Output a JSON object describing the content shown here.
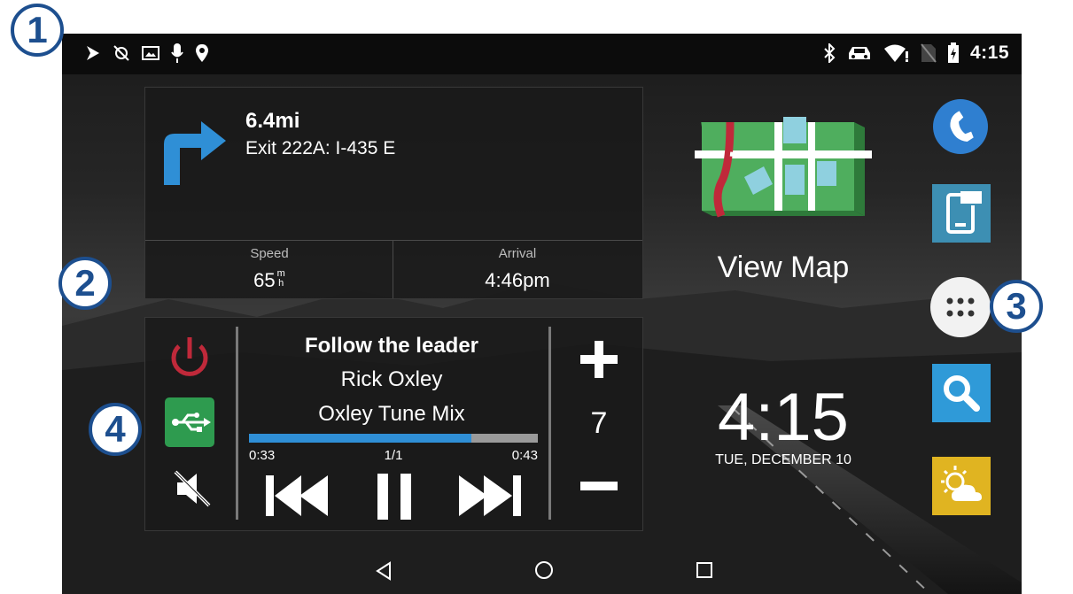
{
  "status_bar": {
    "left_icons": [
      "navigation-icon",
      "no-gps-icon",
      "image-icon",
      "microphone-icon",
      "location-pin-icon"
    ],
    "right_icons": [
      "bluetooth-icon",
      "car-icon",
      "wifi-alert-icon",
      "no-sim-icon",
      "battery-charging-icon"
    ],
    "time": "4:15"
  },
  "navigation": {
    "distance": "6.4mi",
    "instruction": "Exit 222A: I-435 E",
    "speed_label": "Speed",
    "speed_value": "65",
    "speed_unit_top": "m",
    "speed_unit_bottom": "h",
    "arrival_label": "Arrival",
    "arrival_value": "4:46pm"
  },
  "media": {
    "title": "Follow the leader",
    "artist": "Rick Oxley",
    "album": "Oxley Tune Mix",
    "elapsed": "0:33",
    "track_position": "1/1",
    "duration": "0:43",
    "progress": 0.77,
    "volume": "7"
  },
  "view_map": {
    "label": "View Map"
  },
  "clock": {
    "time": "4:15",
    "date": "TUE, DECEMBER 10"
  },
  "apps": [
    "phone-app",
    "smartphone-link-app",
    "app-drawer",
    "search-app",
    "weather-app"
  ],
  "callouts": [
    "1",
    "2",
    "3",
    "4"
  ],
  "colors": {
    "accent_blue": "#2f8fd6",
    "power_red": "#c0293a",
    "usb_green": "#2e9b4f",
    "weather_yellow": "#e0b421",
    "callout_blue": "#1d4f8f"
  }
}
